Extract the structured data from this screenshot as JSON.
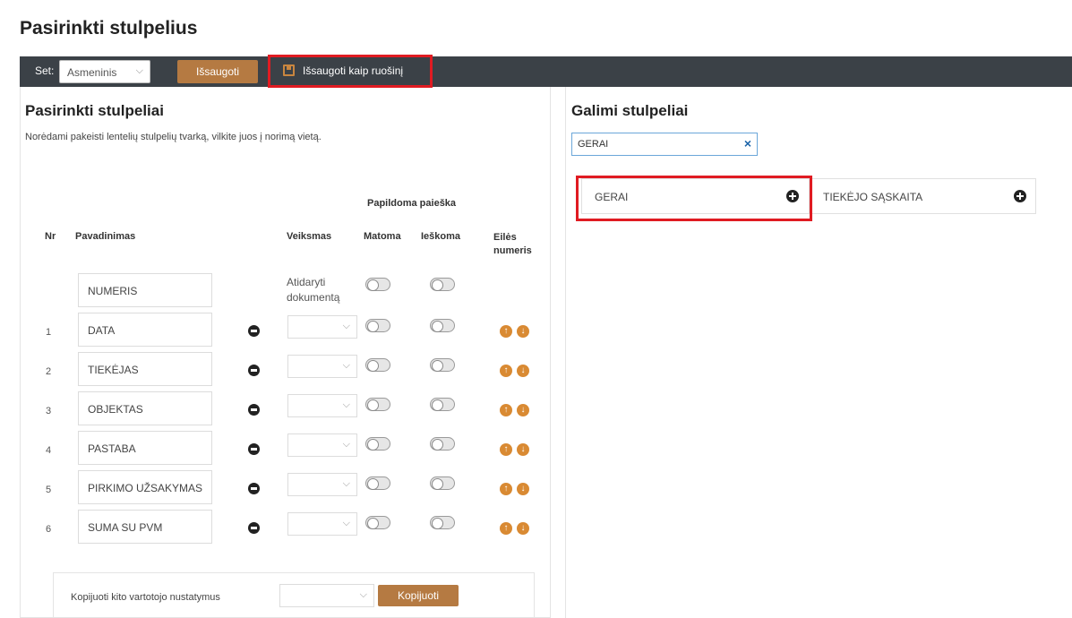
{
  "page_title": "Pasirinkti stulpelius",
  "toolbar": {
    "set_label": "Set:",
    "set_value": "Asmeninis",
    "save_label": "Išsaugoti",
    "save_template_label": "Išsaugoti kaip ruošinį"
  },
  "left": {
    "title": "Pasirinkti stulpeliai",
    "hint": "Norėdami pakeisti lentelių stulpelių tvarką, vilkite juos į norimą vietą.",
    "headers": {
      "group": "Papildoma paieška",
      "nr": "Nr",
      "name": "Pavadinimas",
      "action": "Veiksmas",
      "visible": "Matoma",
      "searchable": "Ieškoma",
      "order": "Eilės numeris"
    },
    "fixed_row": {
      "name": "NUMERIS",
      "action": "Atidaryti dokumentą"
    },
    "rows": [
      {
        "nr": "1",
        "name": "DATA"
      },
      {
        "nr": "2",
        "name": "TIEKĖJAS"
      },
      {
        "nr": "3",
        "name": "OBJEKTAS"
      },
      {
        "nr": "4",
        "name": "PASTABA"
      },
      {
        "nr": "5",
        "name": "PIRKIMO UŽSAKYMAS"
      },
      {
        "nr": "6",
        "name": "SUMA SU PVM"
      }
    ],
    "copy": {
      "label": "Kopijuoti kito vartotojo nustatymus",
      "button": "Kopijuoti"
    }
  },
  "right": {
    "title": "Galimi stulpeliai",
    "search_value": "GERAI",
    "items": [
      {
        "name": "GERAI"
      },
      {
        "name": "TIEKĖJO SĄSKAITA"
      }
    ]
  },
  "colors": {
    "toolbar_bg": "#3b4147",
    "brand_button": "#b57a42",
    "order_arrows": "#d98a33",
    "highlight": "#e01b22"
  }
}
